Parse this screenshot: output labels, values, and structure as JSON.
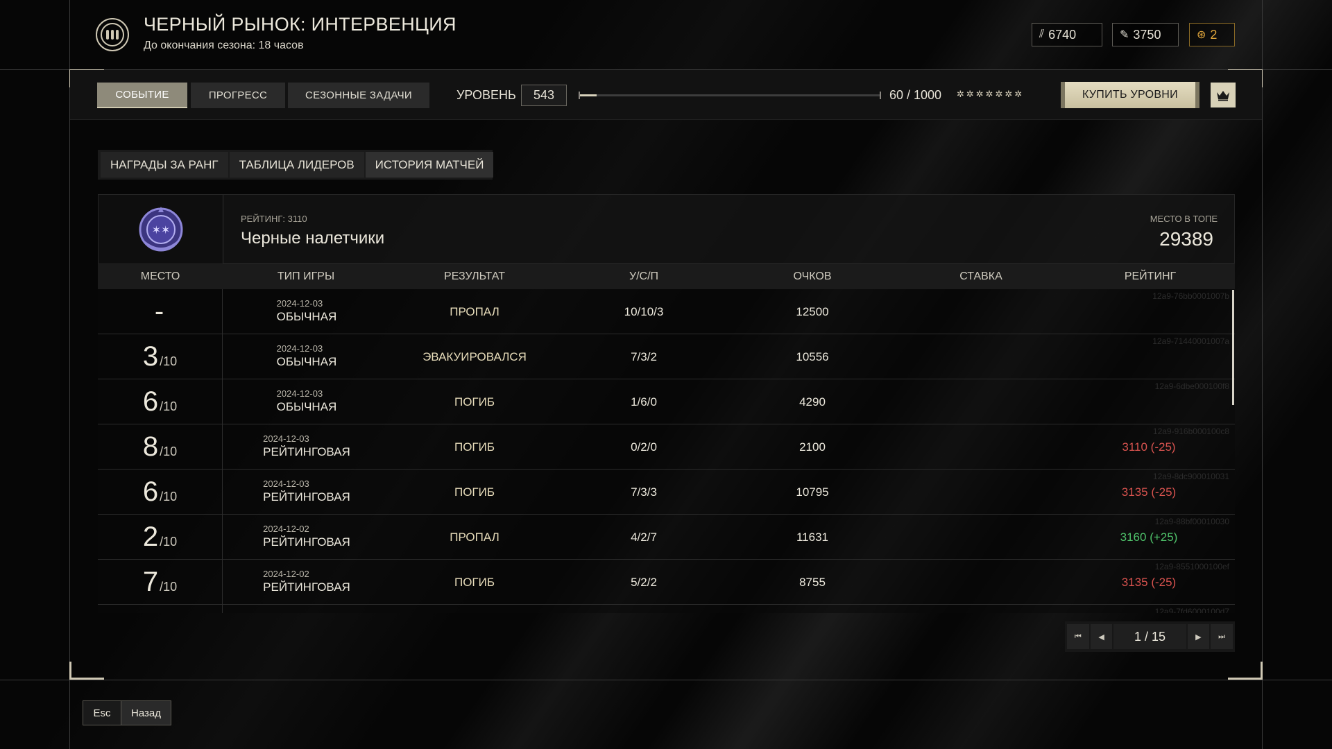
{
  "header": {
    "title": "ЧЕРНЫЙ РЫНОК: ИНТЕРВЕНЦИЯ",
    "subtitle": "До окончания сезона: 18 часов",
    "currencies": [
      {
        "icon": "ammo-currency-icon",
        "value": "6740"
      },
      {
        "icon": "token-currency-icon",
        "value": "3750"
      },
      {
        "icon": "coin-currency-icon",
        "value": "2",
        "color": "#e0a63c"
      }
    ]
  },
  "nav": {
    "tabs": [
      {
        "label": "СОБЫТИЕ",
        "active": true
      },
      {
        "label": "ПРОГРЕСС",
        "active": false
      },
      {
        "label": "СЕЗОННЫЕ ЗАДАЧИ",
        "active": false
      }
    ],
    "level_label": "УРОВЕНЬ",
    "level": "543",
    "progress_text": "60 / 1000",
    "progress_fraction": 0.06,
    "stars": "✲✲✲✲✲✲✲",
    "buy_label": "КУПИТЬ УРОВНИ"
  },
  "subtabs": [
    {
      "label": "НАГРАДЫ ЗА РАНГ",
      "active": false
    },
    {
      "label": "ТАБЛИЦА ЛИДЕРОВ",
      "active": false
    },
    {
      "label": "ИСТОРИЯ МАТЧЕЙ",
      "active": true
    }
  ],
  "team": {
    "rating": "РЕЙТИНГ: 3110",
    "name": "Черные налетчики",
    "top_label": "МЕСТО В ТОПЕ",
    "top_value": "29389"
  },
  "table": {
    "headers": [
      "МЕСТО",
      "ТИП ИГРЫ",
      "РЕЗУЛЬТАТ",
      "У/С/П",
      "ОЧКОВ",
      "СТАВКА",
      "РЕЙТИНГ"
    ],
    "rows": [
      {
        "place": "-",
        "of": "",
        "date": "2024-12-03",
        "type": "ОБЫЧНАЯ",
        "result": "ПРОПАЛ",
        "ksa": "10/10/3",
        "points": "12500",
        "stake": "",
        "rating": "",
        "rating_sign": "",
        "id": "12a9-76bb0001007b"
      },
      {
        "place": "3",
        "of": "/10",
        "date": "2024-12-03",
        "type": "ОБЫЧНАЯ",
        "result": "ЭВАКУИРОВАЛСЯ",
        "ksa": "7/3/2",
        "points": "10556",
        "stake": "",
        "rating": "",
        "rating_sign": "",
        "id": "12a9-71440001007a"
      },
      {
        "place": "6",
        "of": "/10",
        "date": "2024-12-03",
        "type": "ОБЫЧНАЯ",
        "result": "ПОГИБ",
        "ksa": "1/6/0",
        "points": "4290",
        "stake": "",
        "rating": "",
        "rating_sign": "",
        "id": "12a9-6dbe000100f8"
      },
      {
        "place": "8",
        "of": "/10",
        "date": "2024-12-03",
        "type": "РЕЙТИНГОВАЯ",
        "result": "ПОГИБ",
        "ksa": "0/2/0",
        "points": "2100",
        "stake": "",
        "rating": "3110 (-25)",
        "rating_sign": "neg",
        "id": "12a9-916b000100c8"
      },
      {
        "place": "6",
        "of": "/10",
        "date": "2024-12-03",
        "type": "РЕЙТИНГОВАЯ",
        "result": "ПОГИБ",
        "ksa": "7/3/3",
        "points": "10795",
        "stake": "",
        "rating": "3135 (-25)",
        "rating_sign": "neg",
        "id": "12a9-8dc900010031"
      },
      {
        "place": "2",
        "of": "/10",
        "date": "2024-12-02",
        "type": "РЕЙТИНГОВАЯ",
        "result": "ПРОПАЛ",
        "ksa": "4/2/7",
        "points": "11631",
        "stake": "",
        "rating": "3160 (+25)",
        "rating_sign": "pos",
        "id": "12a9-88bf00010030"
      },
      {
        "place": "7",
        "of": "/10",
        "date": "2024-12-02",
        "type": "РЕЙТИНГОВАЯ",
        "result": "ПОГИБ",
        "ksa": "5/2/2",
        "points": "8755",
        "stake": "",
        "rating": "3135 (-25)",
        "rating_sign": "neg",
        "id": "12a9-8551000100ef"
      },
      {
        "place": "",
        "of": "",
        "date": "",
        "type": "",
        "result": "",
        "ksa": "",
        "points": "",
        "stake": "",
        "rating": "",
        "rating_sign": "",
        "id": "12a9-7fd6000100d7"
      }
    ]
  },
  "pager": {
    "text": "1 / 15"
  },
  "footer": {
    "esc": "Esc",
    "back": "Назад"
  }
}
